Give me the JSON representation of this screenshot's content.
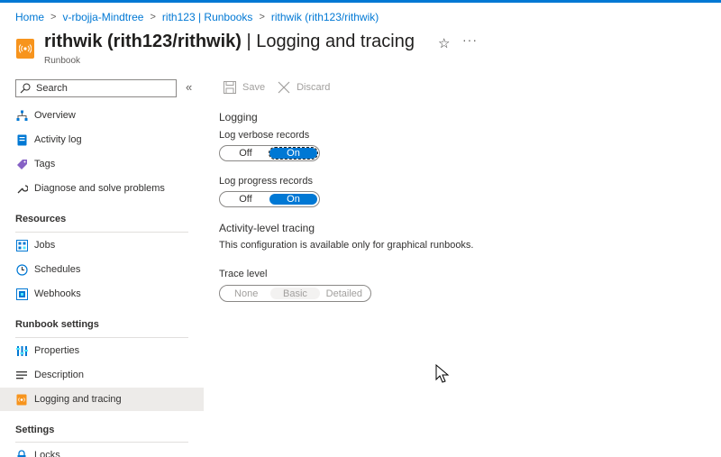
{
  "breadcrumb": {
    "items": [
      "Home",
      "v-rbojja-Mindtree",
      "rith123 | Runbooks",
      "rithwik (rith123/rithwik)"
    ],
    "separator": ">"
  },
  "header": {
    "title_main": "rithwik (rith123/rithwik)",
    "title_sep": " | ",
    "title_page": "Logging and tracing",
    "subtitle": "Runbook",
    "favorite_icon": "star-outline-icon",
    "more_label": "···"
  },
  "sidebar": {
    "search_placeholder": "Search",
    "collapse_label": "«",
    "items_top": [
      {
        "label": "Overview",
        "icon": "overview-icon"
      },
      {
        "label": "Activity log",
        "icon": "activity-log-icon"
      },
      {
        "label": "Tags",
        "icon": "tag-icon"
      },
      {
        "label": "Diagnose and solve problems",
        "icon": "wrench-icon"
      }
    ],
    "section_resources": "Resources",
    "items_resources": [
      {
        "label": "Jobs",
        "icon": "jobs-icon"
      },
      {
        "label": "Schedules",
        "icon": "clock-icon"
      },
      {
        "label": "Webhooks",
        "icon": "webhook-icon"
      }
    ],
    "section_runbook_settings": "Runbook settings",
    "items_runbook_settings": [
      {
        "label": "Properties",
        "icon": "properties-icon"
      },
      {
        "label": "Description",
        "icon": "description-icon"
      },
      {
        "label": "Logging and tracing",
        "icon": "logging-icon",
        "selected": true
      }
    ],
    "section_settings": "Settings",
    "items_settings": [
      {
        "label": "Locks",
        "icon": "lock-icon"
      }
    ]
  },
  "toolbar": {
    "save_label": "Save",
    "discard_label": "Discard"
  },
  "main": {
    "logging_heading": "Logging",
    "verbose_label": "Log verbose records",
    "verbose_off": "Off",
    "verbose_on": "On",
    "verbose_value": "On",
    "progress_label": "Log progress records",
    "progress_off": "Off",
    "progress_on": "On",
    "progress_value": "On",
    "tracing_heading": "Activity-level tracing",
    "tracing_note": "This configuration is available only for graphical runbooks.",
    "trace_level_label": "Trace level",
    "trace_options": [
      "None",
      "Basic",
      "Detailed"
    ],
    "trace_value": "Basic"
  },
  "colors": {
    "accent": "#0078d4",
    "runbook_icon": "#f7941d",
    "selected_bg": "#edebe9",
    "disabled_text": "#a19f9d"
  }
}
